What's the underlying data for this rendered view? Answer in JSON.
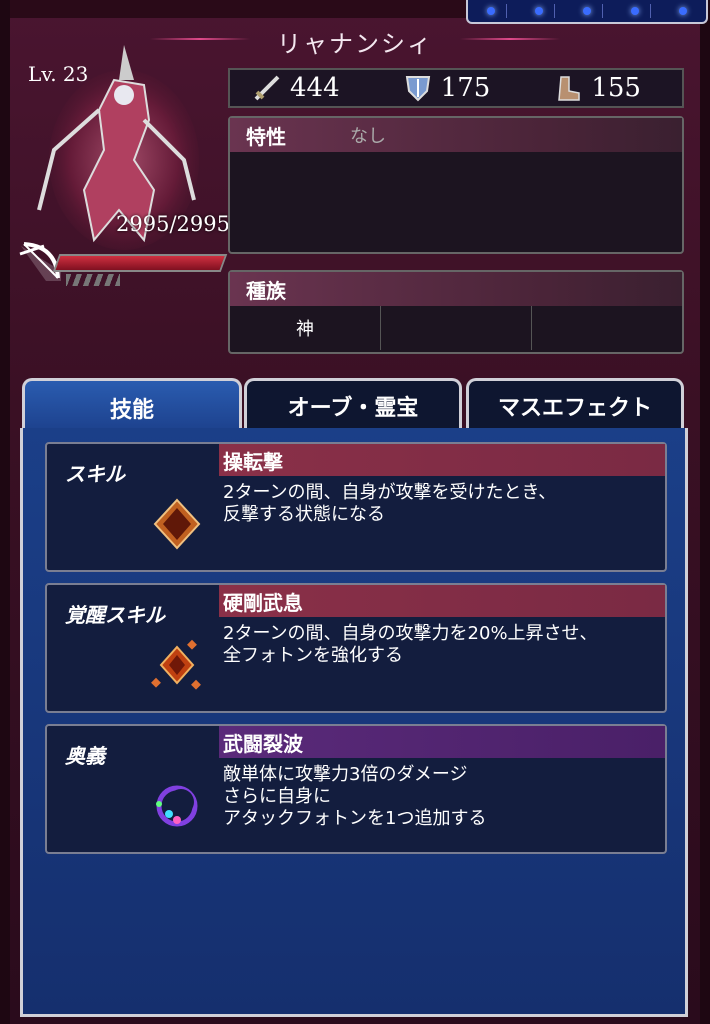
{
  "unit": {
    "name": "リャナンシィ",
    "level": "Lv. 23",
    "hp": "2995/2995"
  },
  "stats": {
    "attack": "444",
    "defense": "175",
    "speed": "155",
    "attack_icon": "sword-icon",
    "defense_icon": "shield-icon",
    "speed_icon": "boot-icon"
  },
  "trait": {
    "label": "特性",
    "value": "なし"
  },
  "race": {
    "label": "種族",
    "cells": [
      "神",
      "",
      ""
    ]
  },
  "tabs": [
    {
      "label": "技能",
      "active": true
    },
    {
      "label": "オーブ・霊宝",
      "active": false
    },
    {
      "label": "マスエフェクト",
      "active": false
    }
  ],
  "skills": [
    {
      "type": "スキル",
      "name": "操転撃",
      "desc": [
        "2ターンの間、自身が攻撃を受けたとき、",
        "反撃する状態になる"
      ]
    },
    {
      "type": "覚醒スキル",
      "name": "硬剛武息",
      "desc": [
        "2ターンの間、自身の攻撃力を20%上昇させ、",
        "全フォトンを強化する"
      ]
    },
    {
      "type": "奥義",
      "name": "武闘裂波",
      "desc": [
        "敵単体に攻撃力3倍のダメージ",
        "さらに自身に",
        "アタックフォトンを1つ追加する"
      ]
    }
  ],
  "colors": {
    "background": "#3a1024",
    "skill_bar": "#8a3048",
    "ougi_bar": "#5a2a7a",
    "tab_active": "#2a5cb0"
  }
}
